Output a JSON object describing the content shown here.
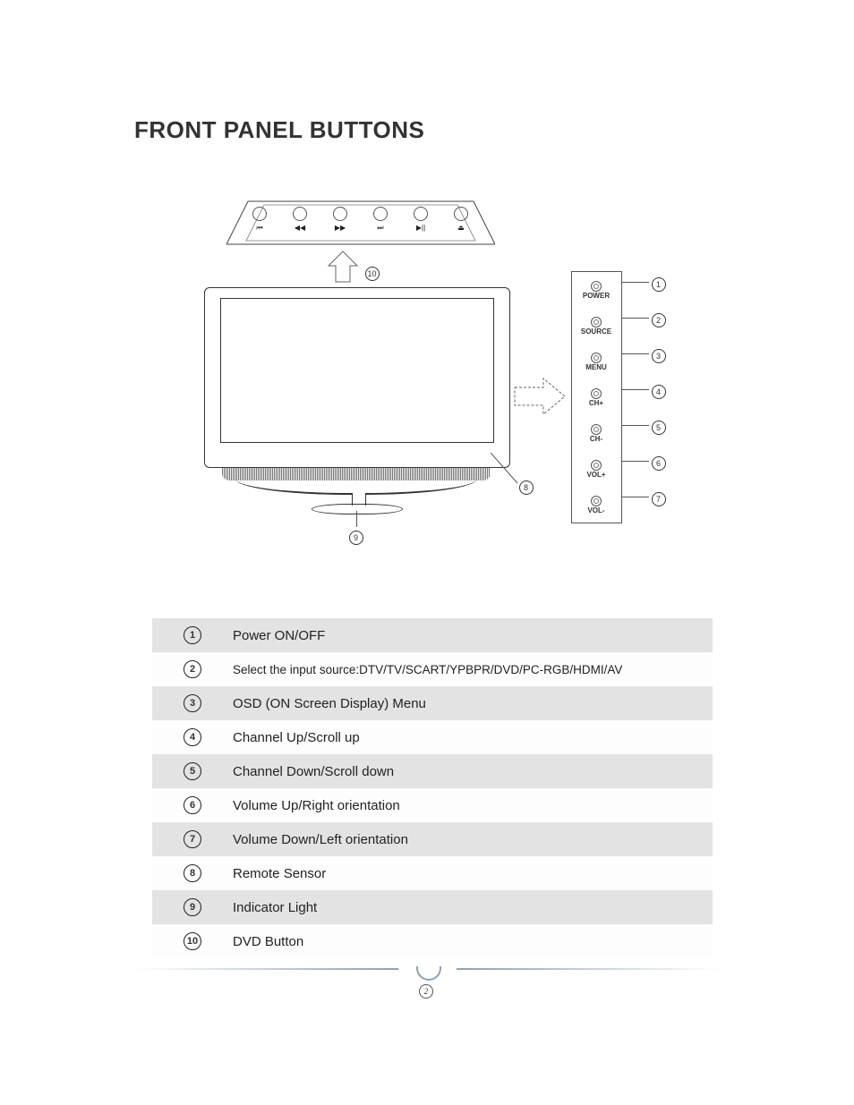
{
  "title": "FRONT PANEL BUTTONS",
  "page_number": "2",
  "dvd_buttons": [
    {
      "glyph": "⏮"
    },
    {
      "glyph": "◀◀"
    },
    {
      "glyph": "▶▶"
    },
    {
      "glyph": "⏭"
    },
    {
      "glyph": "▶||"
    },
    {
      "glyph": "⏏"
    }
  ],
  "side_panel": [
    {
      "label": "POWER",
      "ref": "1"
    },
    {
      "label": "SOURCE",
      "ref": "2"
    },
    {
      "label": "MENU",
      "ref": "3"
    },
    {
      "label": "CH+",
      "ref": "4"
    },
    {
      "label": "CH-",
      "ref": "5"
    },
    {
      "label": "VOL+",
      "ref": "6"
    },
    {
      "label": "VOL-",
      "ref": "7"
    }
  ],
  "callouts": {
    "c8": "8",
    "c9": "9",
    "c10": "10"
  },
  "legend": [
    {
      "num": "1",
      "desc": "Power ON/OFF"
    },
    {
      "num": "2",
      "desc": "Select the input source:DTV/TV/SCART/YPBPR/DVD/PC-RGB/HDMI/AV"
    },
    {
      "num": "3",
      "desc": "OSD (ON Screen Display) Menu"
    },
    {
      "num": "4",
      "desc": "Channel Up/Scroll up"
    },
    {
      "num": "5",
      "desc": "Channel Down/Scroll down"
    },
    {
      "num": "6",
      "desc": "Volume Up/Right orientation"
    },
    {
      "num": "7",
      "desc": "Volume Down/Left orientation"
    },
    {
      "num": "8",
      "desc": "Remote Sensor"
    },
    {
      "num": "9",
      "desc": "Indicator Light"
    },
    {
      "num": "10",
      "desc": "DVD Button"
    }
  ]
}
